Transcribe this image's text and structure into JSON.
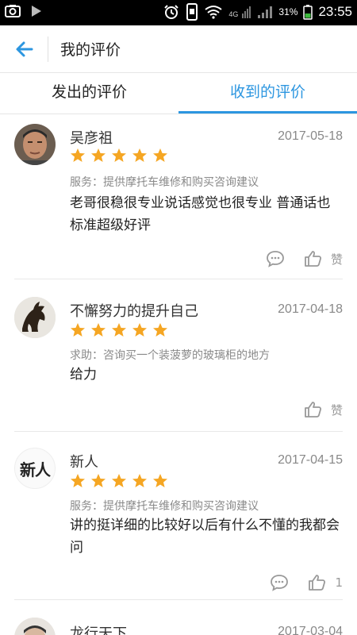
{
  "status_bar": {
    "network": "4G",
    "battery": "31%",
    "time": "23:55"
  },
  "header": {
    "back_icon": "arrow-left-icon",
    "title": "我的评价"
  },
  "tabs": [
    {
      "label": "发出的评价",
      "active": false
    },
    {
      "label": "收到的评价",
      "active": true
    }
  ],
  "colors": {
    "accent": "#2c96e0",
    "star": "#f5a623"
  },
  "reviews": [
    {
      "name": "吴彦祖",
      "date": "2017-05-18",
      "rating": 5,
      "service": "服务：提供摩托车维修和购买咨询建议",
      "comment": "老哥很稳很专业说话感觉也很专业 普通话也标准超级好评",
      "has_comment_icon": true,
      "like_label": "赞"
    },
    {
      "name": "不懈努力的提升自己",
      "date": "2017-04-18",
      "rating": 5,
      "service": "求助：咨询买一个装菠萝的玻璃柜的地方",
      "comment": "给力",
      "has_comment_icon": false,
      "like_label": "赞"
    },
    {
      "name": "新人",
      "avatar_text": "新人",
      "date": "2017-04-15",
      "rating": 5,
      "service": "服务：提供摩托车维修和购买咨询建议",
      "comment": "讲的挺详细的比较好以后有什么不懂的我都会问",
      "has_comment_icon": true,
      "like_label": "1"
    },
    {
      "name": "龙行天下",
      "date": "2017-03-04"
    }
  ]
}
